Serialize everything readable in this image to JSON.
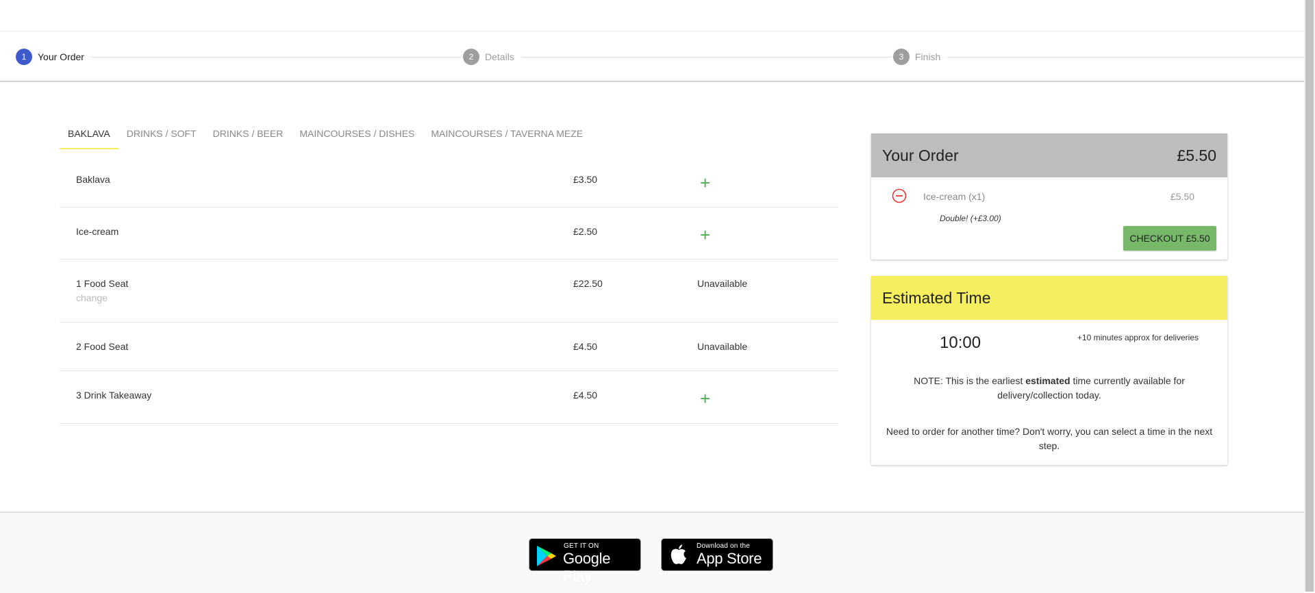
{
  "stepper": {
    "steps": [
      {
        "number": "1",
        "label": "Your Order"
      },
      {
        "number": "2",
        "label": "Details"
      },
      {
        "number": "3",
        "label": "Finish"
      }
    ]
  },
  "tabs": [
    "BAKLAVA",
    "DRINKS / SOFT",
    "DRINKS / BEER",
    "MAINCOURSES / DISHES",
    "MAINCOURSES / TAVERNA MEZE"
  ],
  "menu": {
    "items": [
      {
        "name": "Baklava",
        "price": "£3.50",
        "action": "+"
      },
      {
        "name": "Ice-cream",
        "price": "£2.50",
        "action": "+"
      },
      {
        "name": "1 Food Seat",
        "change": "change",
        "price": "£22.50",
        "status": "Unavailable"
      },
      {
        "name": "2 Food Seat",
        "price": "£4.50",
        "status": "Unavailable"
      },
      {
        "name": "3 Drink Takeaway",
        "price": "£4.50",
        "action": "+"
      }
    ]
  },
  "order": {
    "title": "Your Order",
    "total": "£5.50",
    "line": {
      "name": "Ice-cream (x1)",
      "price": "£5.50",
      "option": "Double! (+£3.00)"
    },
    "checkout_label": "CHECKOUT £5.50"
  },
  "estimate": {
    "title": "Estimated Time",
    "time": "10:00",
    "delivery_note": "+10 minutes approx for deliveries",
    "note_prefix": "NOTE: This is the earliest ",
    "note_bold": "estimated",
    "note_suffix": " time currently available for delivery/collection today.",
    "another_time": "Need to order for another time? Don't worry, you can select a time in the next step."
  },
  "footer": {
    "google_play": {
      "small": "GET IT ON",
      "big": "Google Play"
    },
    "app_store": {
      "small": "Download on the",
      "big": "App Store"
    }
  },
  "colors": {
    "accent_yellow": "#f5ee5f",
    "step_active": "#3f5bcb",
    "add_green": "#4caf50",
    "checkout_green": "#77b86a",
    "remove_red": "#e53935"
  }
}
